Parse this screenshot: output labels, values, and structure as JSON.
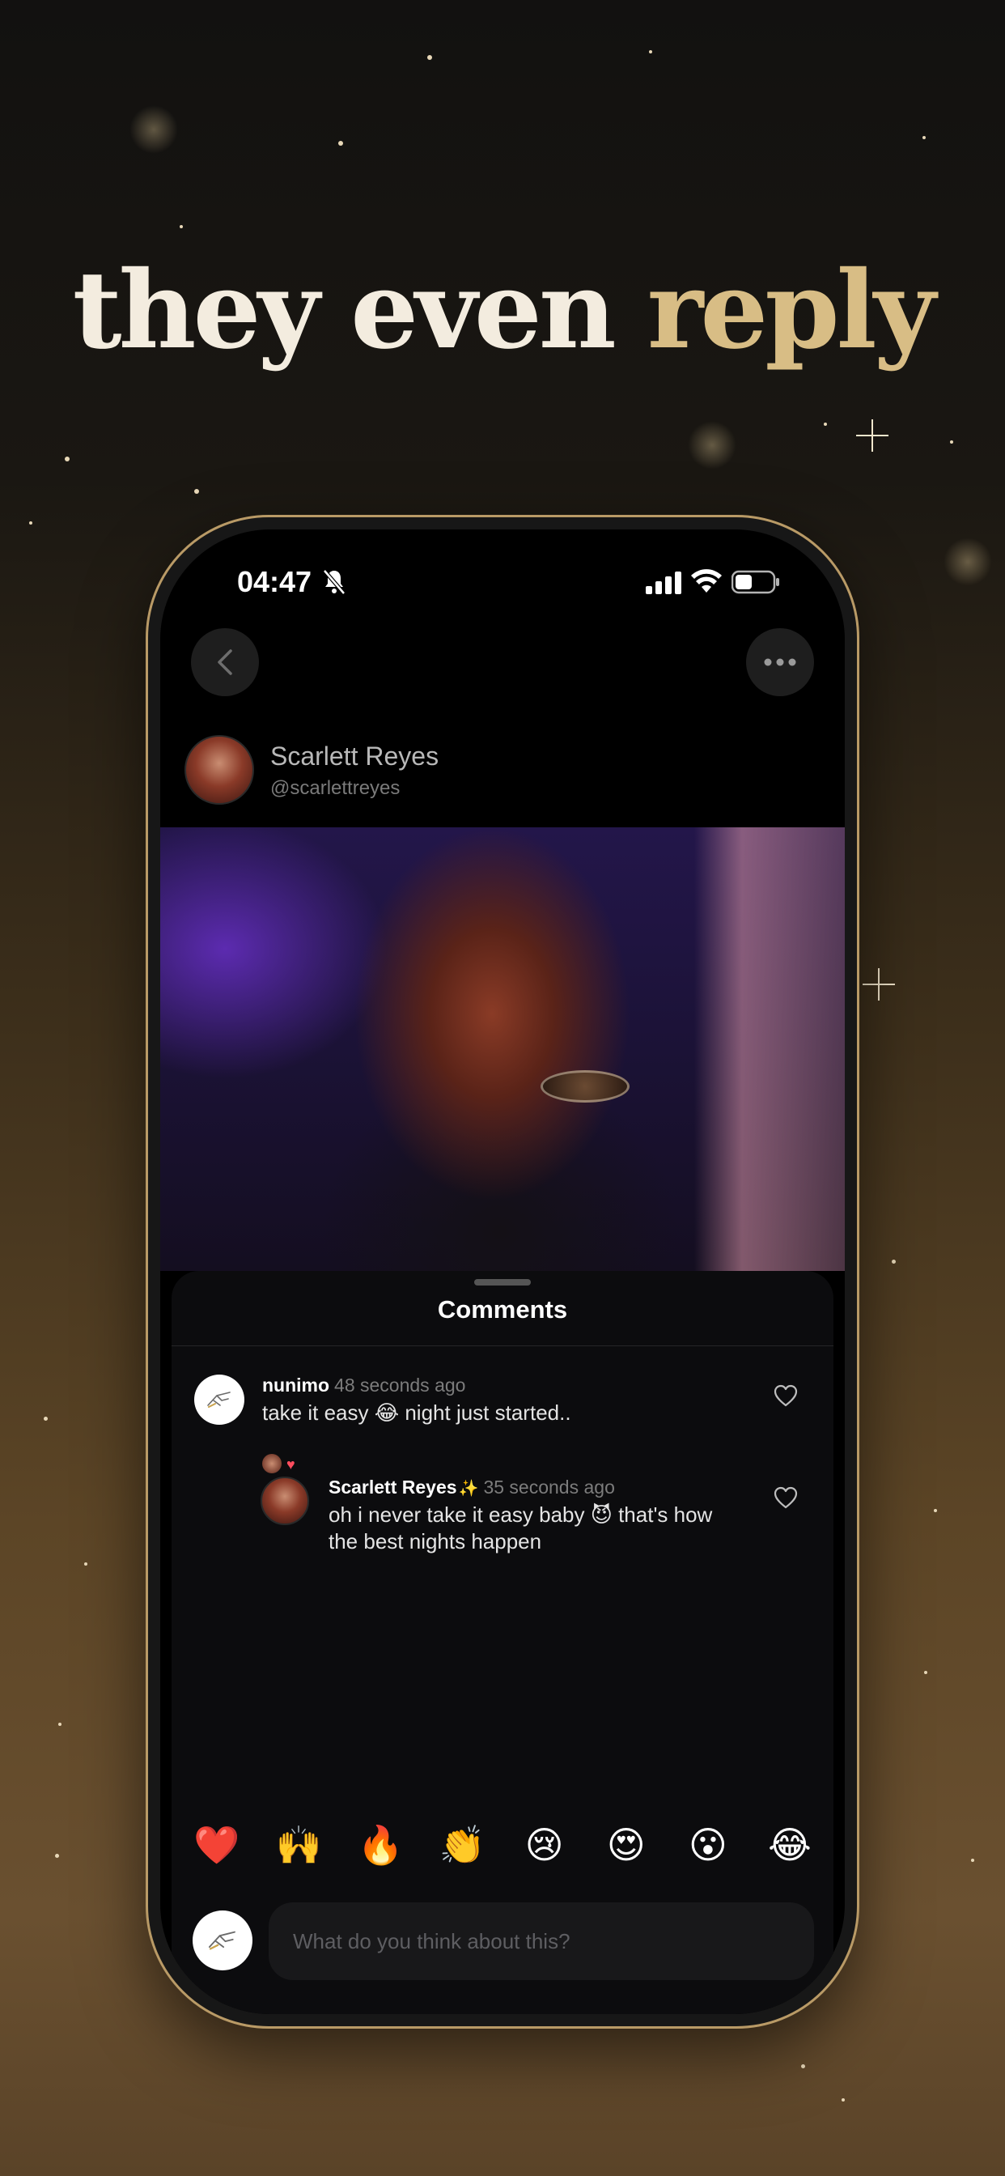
{
  "headline": {
    "part1": "they even ",
    "part2": "reply"
  },
  "status_bar": {
    "time": "04:47"
  },
  "profile": {
    "name": "Scarlett Reyes",
    "handle": "@scarlettreyes"
  },
  "comments_sheet": {
    "title": "Comments",
    "comments": [
      {
        "username": "nunimo",
        "time": "48 seconds ago",
        "text": "take it easy 😂 night just started.."
      },
      {
        "username": "Scarlett Reyes",
        "badge": "✨",
        "time": "35 seconds ago",
        "text": "oh i never take it easy baby 😈 that's how the best nights happen"
      }
    ],
    "reaction_heart": "♥"
  },
  "emoji_bar": [
    "❤️",
    "🙌",
    "🔥",
    "👏",
    "😢",
    "😍",
    "😮",
    "😂"
  ],
  "comment_input": {
    "placeholder": "What do you think about this?"
  },
  "colors": {
    "accent_gold": "#d8bd85",
    "headline_white": "#f3ecdf",
    "frame_gold": "#b99a66"
  }
}
